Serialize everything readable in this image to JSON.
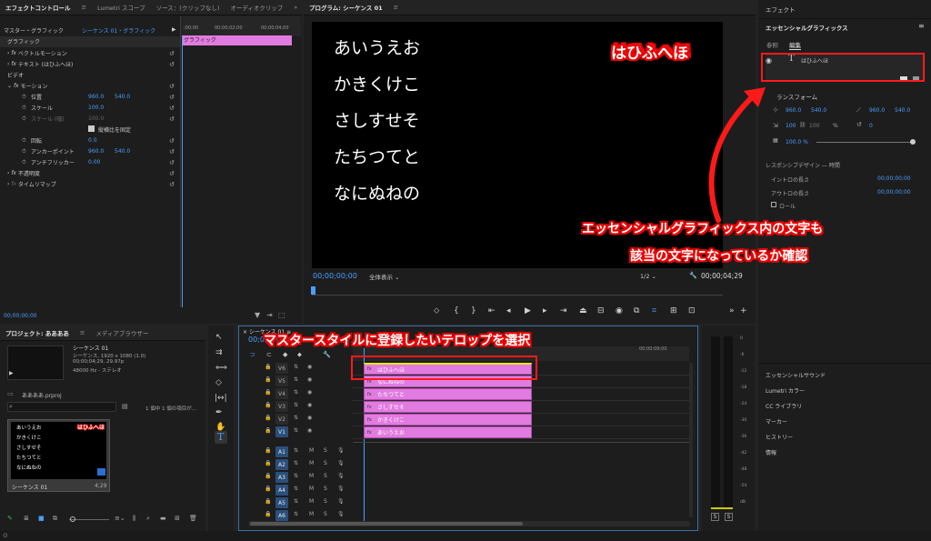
{
  "effect_controls": {
    "tabs": [
      "エフェクトコントロール",
      "≡",
      "Lumetri スコープ",
      "ソース：(クリップなし)",
      "オーディオクリップ"
    ],
    "master_label": "マスター・グラフィック",
    "sequence_label": "シーケンス 01・グラフィック",
    "time_ruler": [
      ":00;00",
      "00;00;02;00",
      "00;00;04;00"
    ],
    "graphic_clip": "グラフィック",
    "sections": {
      "graphic": "グラフィック",
      "vector_motion": "ベクトルモーション",
      "text_layer": "テキスト (はひふへほ)",
      "video": "ビデオ",
      "motion": "モーション",
      "opacity": "不透明度",
      "time_remap": "タイムリマップ"
    },
    "props": [
      {
        "label": "位置",
        "v1": "960.0",
        "v2": "540.0"
      },
      {
        "label": "スケール",
        "v1": "100.0",
        "v2": ""
      },
      {
        "label": "スケール (幅)",
        "v1": "100.0",
        "v2": ""
      },
      {
        "label": "縦横比を固定",
        "v1": "",
        "v2": ""
      },
      {
        "label": "回転",
        "v1": "0.0",
        "v2": ""
      },
      {
        "label": "アンカーポイント",
        "v1": "960.0",
        "v2": "540.0"
      },
      {
        "label": "アンチフリッカー",
        "v1": "0.00",
        "v2": ""
      }
    ],
    "timecode": "00;00;00;00"
  },
  "program": {
    "title": "プログラム: シーケンス 01",
    "lines": [
      "あいうえお",
      "かきくけこ",
      "さしすせそ",
      "たちつてと",
      "なにぬねの"
    ],
    "red_text": "はひふへほ",
    "timecode_left": "00;00;00;00",
    "fit": "全体表示",
    "quality": "1/2",
    "timecode_right": "00;00;04;29"
  },
  "essential_graphics": {
    "panel_title": "エフェクト",
    "title": "エッセンシャルグラフィックス",
    "tabs": [
      "参照",
      "編集"
    ],
    "layer_name": "はひふへほ",
    "transform_label": "ランスフォーム",
    "pos_x": "960.0",
    "pos_y": "540.0",
    "anchor_x": "960.0",
    "anchor_y": "540.0",
    "scale": "100",
    "scale2": "100",
    "pct": "%",
    "rotation": "0",
    "opacity": "100.0 %",
    "responsive": "レスポンシブデザイン — 時間",
    "intro": "イントロの長さ",
    "intro_val": "00;00;00;00",
    "outro": "アウトロの長さ",
    "outro_val": "00;00;00;00",
    "roll": "ロール",
    "menu_items": [
      "エッセンシャルサウンド",
      "Lumetri カラー",
      "CC ライブラリ",
      "マーカー",
      "ヒストリー",
      "情報"
    ]
  },
  "project": {
    "tabs": [
      "プロジェクト: ああああ",
      "メディアブラウザー"
    ],
    "seq_name": "シーケンス 01",
    "seq_info1": "シーケンス, 1920 x 1080 (1.0)",
    "seq_info2": "00;00;04;29, 29.97p",
    "seq_info3": "48000 Hz - ステレオ",
    "file": "ああああ.prproj",
    "count": "1 個中 1 個の項目が...",
    "thumb_lines": [
      "あいうえお",
      "かきくけこ",
      "さしすせそ",
      "たちつてと",
      "なにぬねの"
    ],
    "thumb_red": "はひふへほ",
    "thumb_name": "シーケンス 01",
    "thumb_dur": "4;29"
  },
  "timeline": {
    "tab": "シーケンス 01",
    "timecode": "00;00;00;00",
    "video_tracks": [
      "V6",
      "V5",
      "V4",
      "V3",
      "V2",
      "V1"
    ],
    "audio_tracks": [
      "A1",
      "A2",
      "A3",
      "A4",
      "A5",
      "A6"
    ],
    "clips": [
      "はひふへほ",
      "なにぬねの",
      "たちつてと",
      "さしすせそ",
      "かきくけこ",
      "あいうえお"
    ],
    "ruler_end": "00;00;09;00"
  },
  "meter": {
    "scale": [
      "0",
      "-6",
      "-12",
      "-18",
      "-24",
      "-30",
      "-36",
      "-42",
      "-48",
      "-54",
      "dB"
    ],
    "solo": [
      "S",
      "S"
    ]
  },
  "annotations": {
    "top_right": "はひふへほ",
    "callout1_line1": "エッセンシャルグラフィックス内の文字も",
    "callout1_line2": "該当の文字になっているか確認",
    "callout2": "マスタースタイルに登録したいテロップを選択"
  },
  "colors": {
    "clip": "#e27be0",
    "accent": "#4a9eff",
    "annotation": "#ff1a1a"
  }
}
